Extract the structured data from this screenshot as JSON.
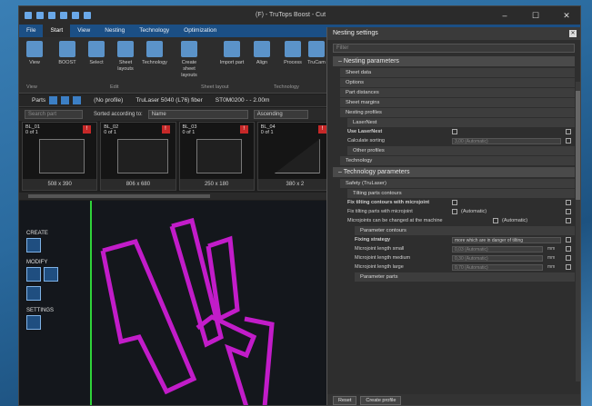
{
  "window": {
    "title": "(F) - TruTops Boost - Cut",
    "controls": [
      "–",
      "☐",
      "✕"
    ]
  },
  "menu": [
    "File",
    "Start",
    "View",
    "Nesting",
    "Technology",
    "Optimization"
  ],
  "ribbon": {
    "buttons": [
      "View",
      "BOOST",
      "Select",
      "Sheet layouts",
      "Technology",
      "Create sheet layouts",
      "Import part",
      "Align",
      "Process",
      "TruCam"
    ],
    "groups": [
      "View",
      "Edit",
      "Sheet layout",
      "Technology"
    ]
  },
  "parts_bar": {
    "label": "Parts",
    "profile": "(No profile)",
    "machine": "TruLaser 5040 (L76) fiber",
    "material": "ST0M0200 - - 2.00m"
  },
  "filter_bar": {
    "search_placeholder": "Search part",
    "sort_label": "Sorted according to:",
    "sort_value": "Name",
    "order_value": "Ascending"
  },
  "cards": [
    {
      "name": "BL_01",
      "qty": "0 of 1",
      "dim": "508 x 390"
    },
    {
      "name": "BL_02",
      "qty": "0 of 1",
      "dim": "806 x 680"
    },
    {
      "name": "BL_03",
      "qty": "0 of 1",
      "dim": "250 x 180"
    },
    {
      "name": "BL_04",
      "qty": "0 of 1",
      "dim": "380 x 2"
    }
  ],
  "tools": {
    "create": "CREATE",
    "modify": "MODIFY",
    "settings": "SETTINGS"
  },
  "panel": {
    "title": "Nesting settings",
    "filter_placeholder": "Filter",
    "nesting": {
      "header": "Nesting parameters",
      "items": [
        "Sheet data",
        "Options",
        "Part distances",
        "Sheet margins",
        "Nesting profiles"
      ],
      "sub": "LaserNest",
      "use_label": "Use LaserNest",
      "calc_label": "Calculate sorting",
      "calc_value": "3,00 (Automatic)",
      "other": "Other profiles"
    },
    "technology": "Technology",
    "tech_params": {
      "header": "Technology parameters",
      "safety": "Safety (TruLaser)",
      "tilting": "Tilting parts contours",
      "fix1": "Fix tilting contours with microjoint",
      "fix2": "Fix tilting parts with microjoint",
      "auto": "(Automatic)",
      "mj_change": "Microjoints can be changed at the machine",
      "param_contours": "Parameter contours",
      "fixing": "Fixing strategy",
      "fixing_value": "more which are in danger of tilting",
      "mj_small": "Microjoint length small",
      "mj_medium": "Microjoint length medium",
      "mj_large": "Microjoint length large",
      "mj_small_v": "0,03 (Automatic)",
      "mj_medium_v": "0,30 (Automatic)",
      "mj_large_v": "0,70 (Automatic)",
      "unit": "mm",
      "param_parts": "Parameter parts"
    },
    "footer": {
      "reset": "Reset",
      "create": "Create profile"
    }
  }
}
